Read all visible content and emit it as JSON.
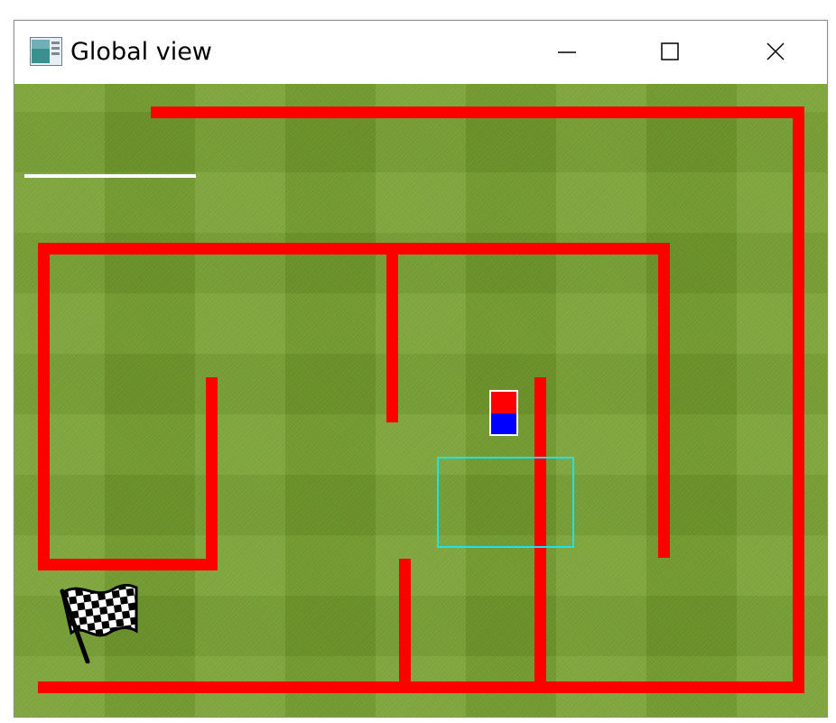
{
  "window": {
    "title": "Global view",
    "app_icon": "window-app-icon",
    "controls": {
      "minimize_icon": "minimize-icon",
      "maximize_icon": "maximize-icon",
      "close_icon": "close-icon"
    }
  },
  "scene": {
    "background": "grass-texture",
    "wall_color": "#ff0000",
    "robot": {
      "front_color": "#ff0000",
      "back_color": "#0000ff"
    },
    "sensor_region_color": "#22e0e8",
    "goal_icon": "checkered-flag-icon",
    "progress_line_color": "#ffffff"
  }
}
